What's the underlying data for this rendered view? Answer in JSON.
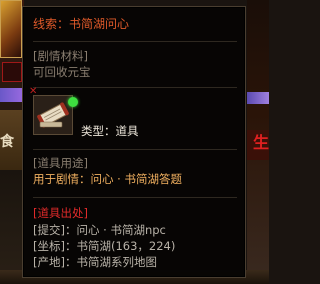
{
  "left_edge": {
    "char": "食"
  },
  "right_edge": {
    "char": "生"
  },
  "tooltip": {
    "title": "线索：书简湖问心",
    "category_header": "[剧情材料]",
    "category_text": "可回收元宝",
    "item": {
      "icon": "scroll-bundle-icon",
      "type_label": "类型：道具"
    },
    "usage_header": "[道具用途]",
    "usage_text": "用于剧情：问心 · 书简湖答题",
    "source_header": "[道具出处]",
    "source_lines": [
      "[提交]：问心 · 书简湖npc",
      "[坐标]：书简湖(163，224)",
      "[产地]：书简湖系列地图"
    ]
  },
  "colors": {
    "title": "#e05a2a",
    "usage": "#f0b060",
    "source_header": "#e02a2a",
    "muted": "#8a7e70"
  }
}
